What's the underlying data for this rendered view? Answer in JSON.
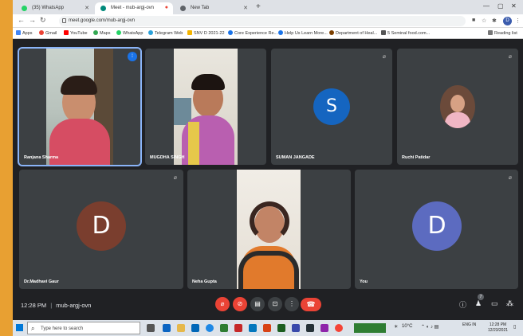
{
  "browser": {
    "tabs": [
      {
        "label": "(35) WhatsApp",
        "fav_color": "#25d366"
      },
      {
        "label": "Meet - mub-argj-ovn",
        "fav_color": "#00897b"
      },
      {
        "label": "New Tab",
        "fav_color": "#5f6368"
      }
    ],
    "new_tab_symbol": "+",
    "url": "meet.google.com/mub-argj-ovn",
    "profile_initial": "D",
    "bookmarks": [
      {
        "label": "Apps",
        "color": "#4285f4"
      },
      {
        "label": "Gmail",
        "color": "#ea4335"
      },
      {
        "label": "YouTube",
        "color": "#ff0000"
      },
      {
        "label": "Maps",
        "color": "#34a853"
      },
      {
        "label": "WhatsApp",
        "color": "#25d366"
      },
      {
        "label": "Telegram Web",
        "color": "#2aa1da"
      },
      {
        "label": "SNV D 2021-22",
        "color": "#f4b400"
      },
      {
        "label": "Core Experience Re...",
        "color": "#1a73e8"
      },
      {
        "label": "Help Us Learn More...",
        "color": "#1a73e8"
      },
      {
        "label": "Department of Heal...",
        "color": "#7b3f00"
      },
      {
        "label": "5 Seminal food.com...",
        "color": "#555555"
      }
    ],
    "reading_list": "Reading list"
  },
  "meet": {
    "participants": [
      {
        "name": "Ranjana Sharma",
        "type": "video"
      },
      {
        "name": "MUGDHA SINGH",
        "type": "video"
      },
      {
        "name": "SUMAN JANGADE",
        "type": "avatar",
        "initial": "S",
        "color": "#1565c0"
      },
      {
        "name": "Ruchi Patidar",
        "type": "photo"
      },
      {
        "name": "Dr.Madhavi Gaur",
        "type": "avatar",
        "initial": "D",
        "color": "#7a3e2e"
      },
      {
        "name": "Neha Gupta",
        "type": "video"
      },
      {
        "name": "You",
        "type": "avatar",
        "initial": "D",
        "color": "#5c6bc0"
      }
    ],
    "time": "12:28 PM",
    "separator": "|",
    "meeting_code": "mub-argj-ovn",
    "participant_count": "7"
  },
  "taskbar": {
    "search_placeholder": "Type here to search",
    "temperature": "10°C",
    "language": "ENG IN",
    "time": "12:28 PM",
    "date": "12/23/2021"
  }
}
